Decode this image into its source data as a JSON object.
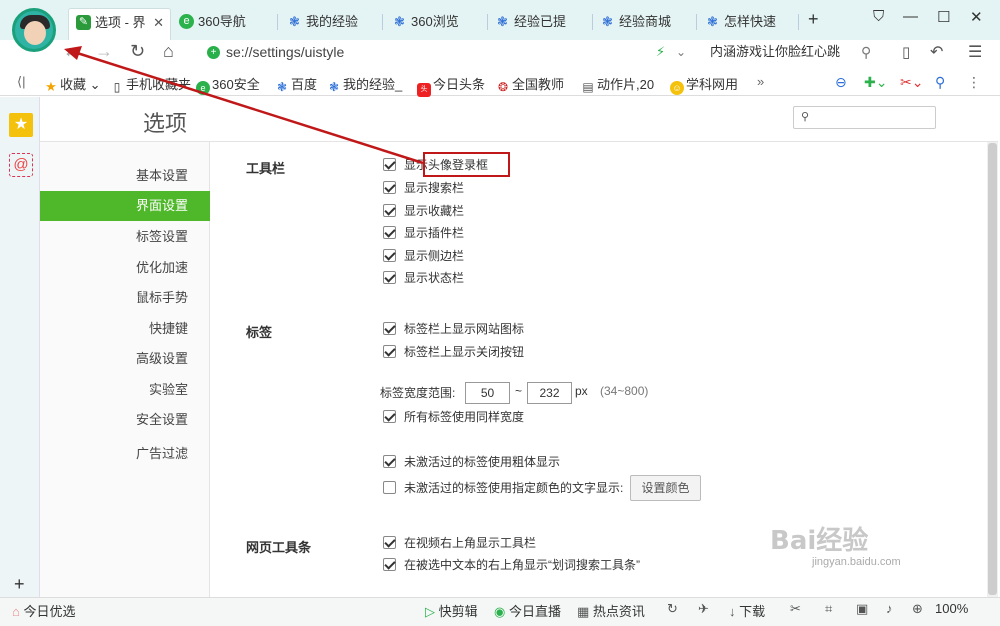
{
  "browser": {
    "tabs": [
      {
        "label": "选项 - 界",
        "color": "#2a9a3a"
      },
      {
        "label": "360导航",
        "color": "#2bb24c"
      },
      {
        "label": "我的经验",
        "color": "#2d6fd6"
      },
      {
        "label": "360浏览",
        "color": "#2d6fd6"
      },
      {
        "label": "经验已提",
        "color": "#2d6fd6"
      },
      {
        "label": "经验商城",
        "color": "#2d6fd6"
      },
      {
        "label": "怎样快速",
        "color": "#2d6fd6"
      }
    ],
    "url": "se://settings/uistyle",
    "search_text": "内涵游戏让你脸红心跳",
    "bookmarks": [
      "收藏",
      "手机收藏夹",
      "360安全",
      "百度",
      "我的经验_",
      "今日头条",
      "全国教师",
      "动作片,20",
      "学科网用"
    ]
  },
  "settings": {
    "title": "选项",
    "search_placeholder": "",
    "menu": [
      "基本设置",
      "界面设置",
      "标签设置",
      "优化加速",
      "鼠标手势",
      "快捷键",
      "高级设置",
      "实验室",
      "安全设置",
      "广告过滤"
    ],
    "sections": {
      "toolbar": {
        "label": "工具栏",
        "options": [
          {
            "text": "显示头像登录框",
            "checked": true
          },
          {
            "text": "显示搜索栏",
            "checked": true
          },
          {
            "text": "显示收藏栏",
            "checked": true
          },
          {
            "text": "显示插件栏",
            "checked": true
          },
          {
            "text": "显示侧边栏",
            "checked": true
          },
          {
            "text": "显示状态栏",
            "checked": true
          }
        ]
      },
      "tabs": {
        "label": "标签",
        "options": [
          {
            "text": "标签栏上显示网站图标",
            "checked": true
          },
          {
            "text": "标签栏上显示关闭按钮",
            "checked": true
          }
        ],
        "width_label": "标签宽度范围:",
        "width_min": "50",
        "width_max": "232",
        "width_unit": "px",
        "width_range": "(34~800)",
        "same_width": {
          "text": "所有标签使用同样宽度",
          "checked": true
        },
        "bold_inactive": {
          "text": "未激活过的标签使用粗体显示",
          "checked": true
        },
        "color_inactive": {
          "text": "未激活过的标签使用指定颜色的文字显示:",
          "checked": false
        },
        "color_button": "设置颜色"
      },
      "webbar": {
        "label": "网页工具条",
        "options": [
          {
            "text": "在视频右上角显示工具栏",
            "checked": true
          },
          {
            "text": "在被选中文本的右上角显示“划词搜索工具条”",
            "checked": true
          }
        ]
      }
    }
  },
  "statusbar": {
    "left": "今日优选",
    "items": [
      "快剪辑",
      "今日直播",
      "热点资讯",
      "下载"
    ],
    "zoom": "100%"
  },
  "watermark": {
    "text": "Bai经验",
    "sub": "jingyan.baidu.com"
  },
  "accent": "#4fb82a"
}
